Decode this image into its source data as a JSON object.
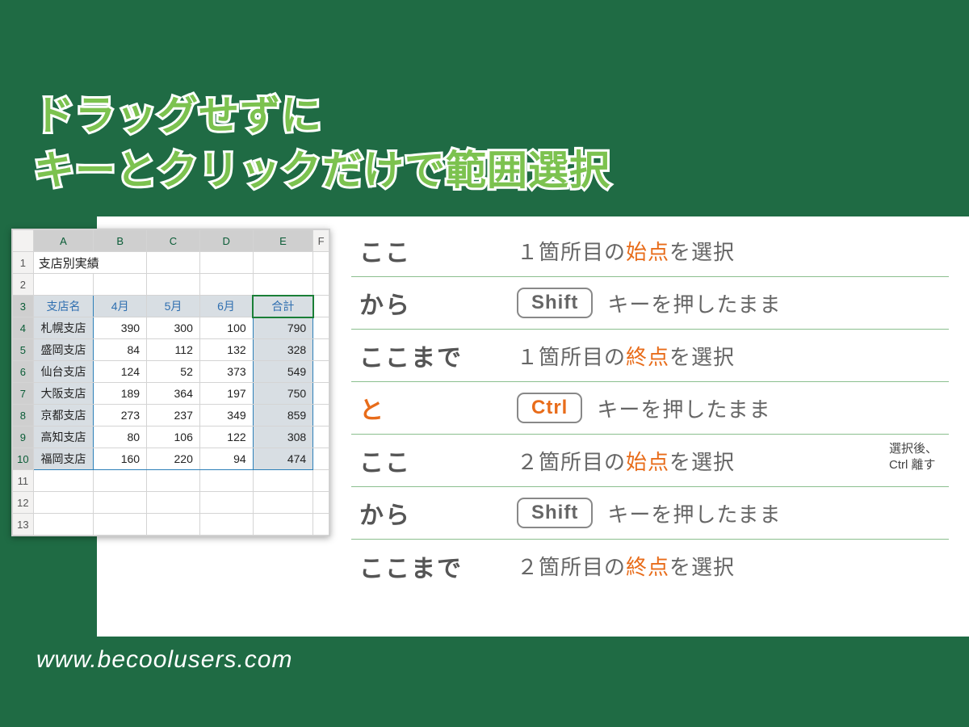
{
  "title_line1": "ドラッグせずに",
  "title_line2": "キーとクリックだけで範囲選択",
  "url": "www.becoolusers.com",
  "sheet": {
    "cols": [
      "A",
      "B",
      "C",
      "D",
      "E",
      "F"
    ],
    "title": "支店別実績",
    "headers": {
      "a": "支店名",
      "b": "4月",
      "c": "5月",
      "d": "6月",
      "e": "合計"
    },
    "rows": [
      {
        "name": "札幌支店",
        "b": 390,
        "c": 300,
        "d": 100,
        "e": 790
      },
      {
        "name": "盛岡支店",
        "b": 84,
        "c": 112,
        "d": 132,
        "e": 328
      },
      {
        "name": "仙台支店",
        "b": 124,
        "c": 52,
        "d": 373,
        "e": 549
      },
      {
        "name": "大阪支店",
        "b": 189,
        "c": 364,
        "d": 197,
        "e": 750
      },
      {
        "name": "京都支店",
        "b": 273,
        "c": 237,
        "d": 349,
        "e": 859
      },
      {
        "name": "高知支店",
        "b": 80,
        "c": 106,
        "d": 122,
        "e": 308
      },
      {
        "name": "福岡支店",
        "b": 160,
        "c": 220,
        "d": 94,
        "e": 474
      }
    ]
  },
  "keys": {
    "shift": "Shift",
    "ctrl": "Ctrl"
  },
  "steps": {
    "s1": {
      "left": "ここ",
      "pre": "１箇所目の",
      "em": "始点",
      "post": "を選択"
    },
    "s2": {
      "left": "から",
      "key": "shift",
      "post": "キーを押したまま"
    },
    "s3": {
      "left": "ここまで",
      "pre": "１箇所目の",
      "em": "終点",
      "post": "を選択"
    },
    "s4": {
      "left": "と",
      "key": "ctrl",
      "post": "キーを押したまま"
    },
    "s5": {
      "left": "ここ",
      "pre": "２箇所目の",
      "em": "始点",
      "post": "を選択",
      "note_l1": "選択後、",
      "note_l2": "Ctrl 離す"
    },
    "s6": {
      "left": "から",
      "key": "shift",
      "post": "キーを押したまま"
    },
    "s7": {
      "left": "ここまで",
      "pre": "２箇所目の",
      "em": "終点",
      "post": "を選択"
    }
  }
}
